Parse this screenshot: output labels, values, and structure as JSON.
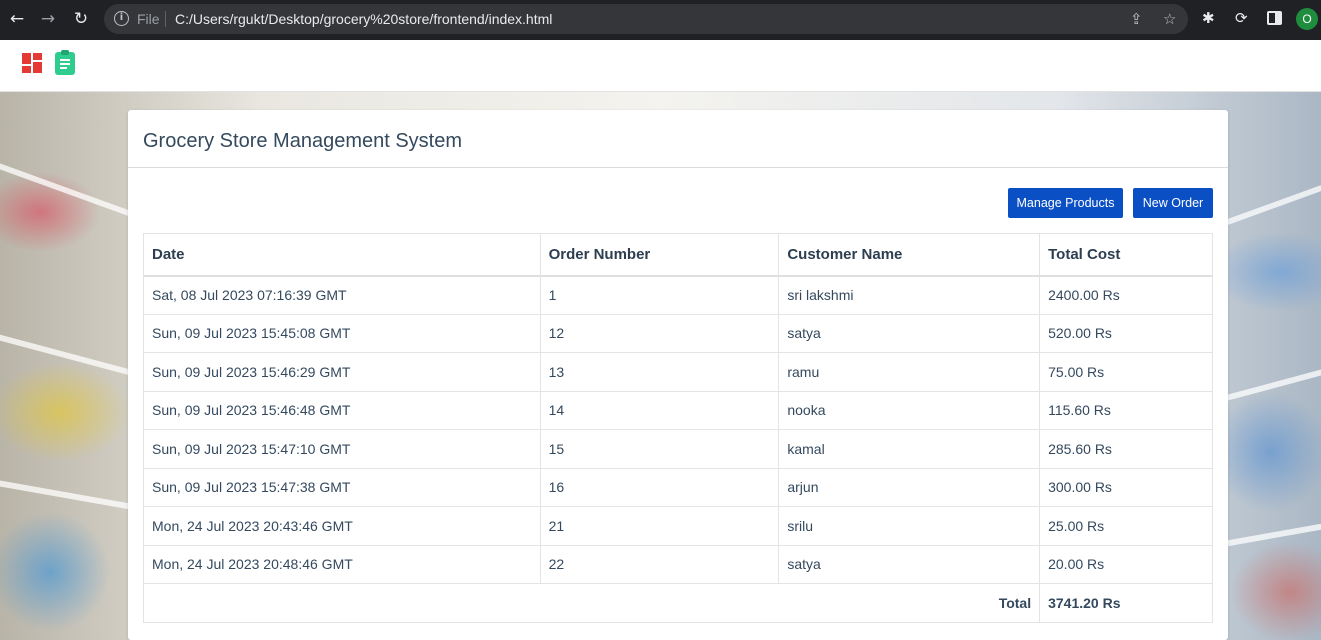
{
  "browser": {
    "file_label": "File",
    "url": "C:/Users/rgukt/Desktop/grocery%20store/frontend/index.html",
    "profile_initial": "O"
  },
  "app": {
    "title": "Grocery Store Management System",
    "buttons": {
      "manage_products": "Manage Products",
      "new_order": "New Order"
    },
    "table": {
      "headers": [
        "Date",
        "Order Number",
        "Customer Name",
        "Total Cost"
      ],
      "rows": [
        [
          "Sat, 08 Jul 2023 07:16:39 GMT",
          "1",
          "sri lakshmi",
          "2400.00 Rs"
        ],
        [
          "Sun, 09 Jul 2023 15:45:08 GMT",
          "12",
          "satya",
          "520.00 Rs"
        ],
        [
          "Sun, 09 Jul 2023 15:46:29 GMT",
          "13",
          "ramu",
          "75.00 Rs"
        ],
        [
          "Sun, 09 Jul 2023 15:46:48 GMT",
          "14",
          "nooka",
          "115.60 Rs"
        ],
        [
          "Sun, 09 Jul 2023 15:47:10 GMT",
          "15",
          "kamal",
          "285.60 Rs"
        ],
        [
          "Sun, 09 Jul 2023 15:47:38 GMT",
          "16",
          "arjun",
          "300.00 Rs"
        ],
        [
          "Mon, 24 Jul 2023 20:43:46 GMT",
          "21",
          "srilu",
          "25.00 Rs"
        ],
        [
          "Mon, 24 Jul 2023 20:48:46 GMT",
          "22",
          "satya",
          "20.00 Rs"
        ]
      ],
      "total_label": "Total",
      "total_value": "3741.20 Rs"
    }
  },
  "icons": {
    "dashboard": "dashboard-icon",
    "orders": "clipboard-icon"
  },
  "colors": {
    "accent_button": "#0b4fc4",
    "dashboard_logo": "#e53935",
    "clipboard_logo": "#2ecc8f"
  }
}
